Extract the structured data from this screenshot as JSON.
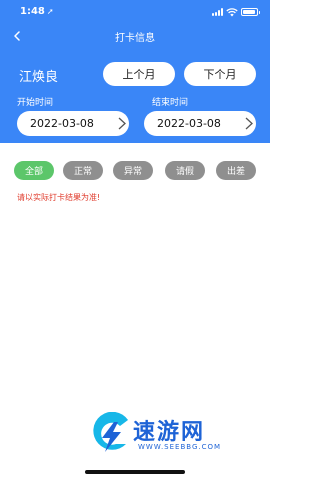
{
  "status_bar": {
    "time": "1:48",
    "location_glyph": "➚",
    "signal_bars": 4,
    "battery_level": 0.9
  },
  "nav": {
    "title": "打卡信息",
    "back_icon": "chevron-left-icon"
  },
  "user": {
    "name": "江焕良"
  },
  "month_buttons": {
    "prev": "上个月",
    "next": "下个月"
  },
  "range": {
    "start_label": "开始时间",
    "end_label": "结束时间",
    "start_date": "2022-03-08",
    "end_date": "2022-03-08"
  },
  "filters": [
    {
      "label": "全部",
      "active": true
    },
    {
      "label": "正常",
      "active": false
    },
    {
      "label": "异常",
      "active": false
    },
    {
      "label": "请假",
      "active": false
    },
    {
      "label": "出差",
      "active": false
    }
  ],
  "note": "请以实际打卡结果为准!",
  "watermark": {
    "text": "速游网",
    "url": "WWW.SEEBBG.COM"
  },
  "colors": {
    "header": "#3a86f7",
    "chip_active": "#5cc66a",
    "chip_inactive": "#8f8f8f",
    "note": "#e03b2c"
  }
}
